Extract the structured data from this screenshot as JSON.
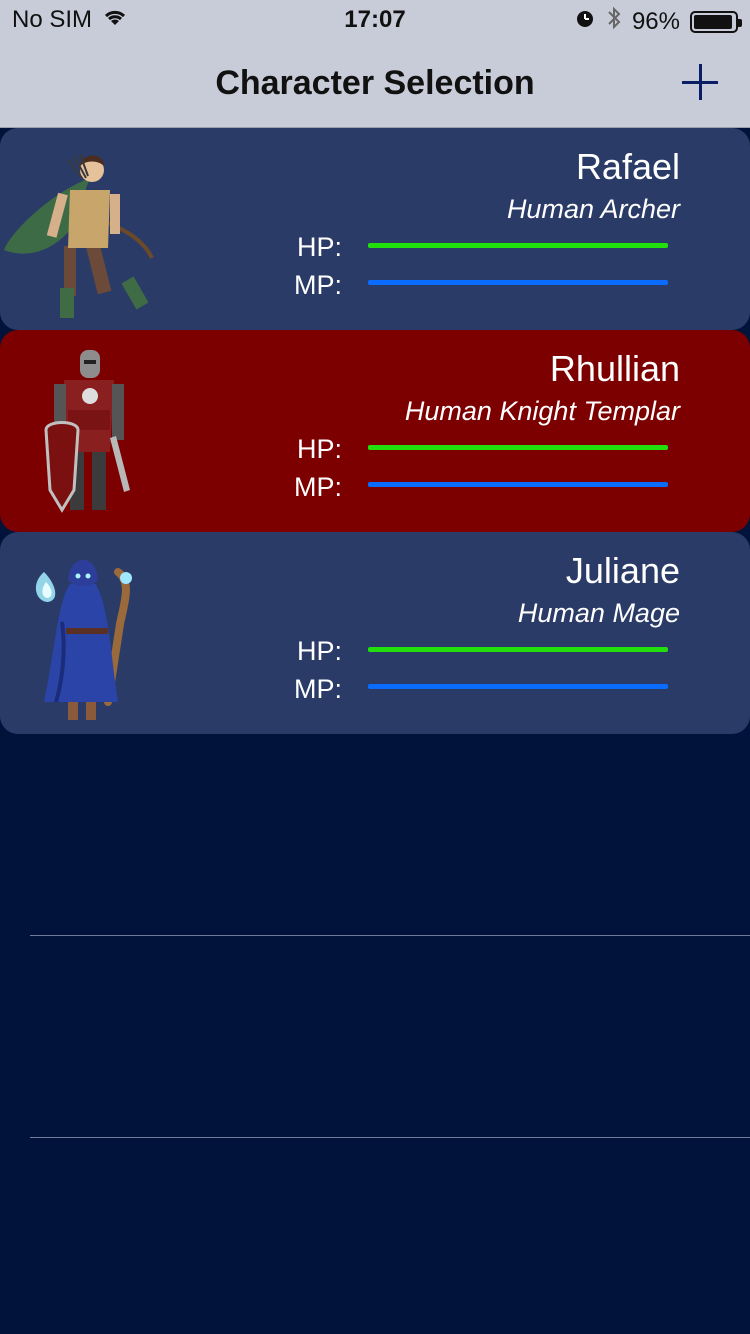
{
  "status_bar": {
    "carrier": "No SIM",
    "time": "17:07",
    "battery_percent": "96%",
    "battery_level": 0.96
  },
  "nav": {
    "title": "Character Selection",
    "add_icon": "plus-icon"
  },
  "colors": {
    "card_default": "#2b3b67",
    "card_selected": "#7d0000",
    "hp_bar": "#22e00b",
    "mp_bar": "#0a6bff",
    "background": "#01133a"
  },
  "characters": [
    {
      "name": "Rafael",
      "role": "Human Archer",
      "hp_label": "HP:",
      "mp_label": "MP:",
      "hp_fraction": 1.0,
      "mp_fraction": 1.0,
      "portrait_icon": "archer-portrait-icon"
    },
    {
      "name": "Rhullian",
      "role": "Human Knight Templar",
      "hp_label": "HP:",
      "mp_label": "MP:",
      "hp_fraction": 1.0,
      "mp_fraction": 1.0,
      "portrait_icon": "knight-portrait-icon"
    },
    {
      "name": "Juliane",
      "role": "Human Mage",
      "hp_label": "HP:",
      "mp_label": "MP:",
      "hp_fraction": 1.0,
      "mp_fraction": 1.0,
      "portrait_icon": "mage-portrait-icon"
    }
  ]
}
